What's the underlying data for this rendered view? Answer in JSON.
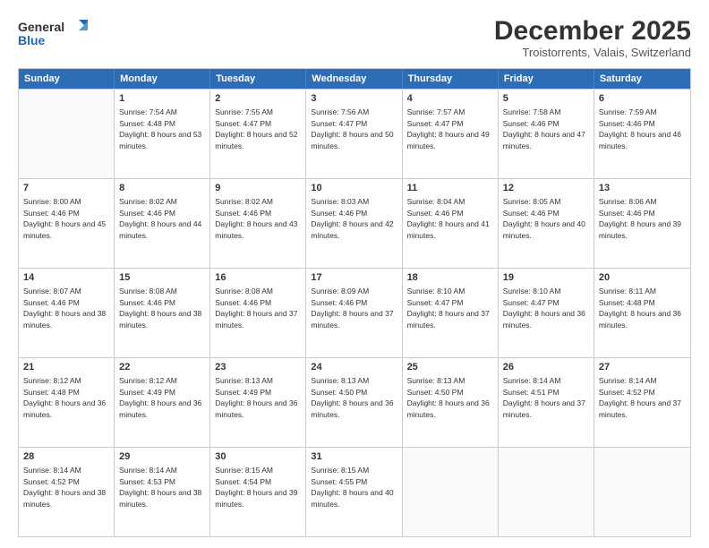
{
  "header": {
    "logo_line1": "General",
    "logo_line2": "Blue",
    "month": "December 2025",
    "location": "Troistorrents, Valais, Switzerland"
  },
  "days_of_week": [
    "Sunday",
    "Monday",
    "Tuesday",
    "Wednesday",
    "Thursday",
    "Friday",
    "Saturday"
  ],
  "weeks": [
    [
      {
        "day": "",
        "empty": true
      },
      {
        "day": "1",
        "sunrise": "7:54 AM",
        "sunset": "4:48 PM",
        "daylight": "8 hours and 53 minutes."
      },
      {
        "day": "2",
        "sunrise": "7:55 AM",
        "sunset": "4:47 PM",
        "daylight": "8 hours and 52 minutes."
      },
      {
        "day": "3",
        "sunrise": "7:56 AM",
        "sunset": "4:47 PM",
        "daylight": "8 hours and 50 minutes."
      },
      {
        "day": "4",
        "sunrise": "7:57 AM",
        "sunset": "4:47 PM",
        "daylight": "8 hours and 49 minutes."
      },
      {
        "day": "5",
        "sunrise": "7:58 AM",
        "sunset": "4:46 PM",
        "daylight": "8 hours and 47 minutes."
      },
      {
        "day": "6",
        "sunrise": "7:59 AM",
        "sunset": "4:46 PM",
        "daylight": "8 hours and 46 minutes."
      }
    ],
    [
      {
        "day": "7",
        "sunrise": "8:00 AM",
        "sunset": "4:46 PM",
        "daylight": "8 hours and 45 minutes."
      },
      {
        "day": "8",
        "sunrise": "8:02 AM",
        "sunset": "4:46 PM",
        "daylight": "8 hours and 44 minutes."
      },
      {
        "day": "9",
        "sunrise": "8:02 AM",
        "sunset": "4:46 PM",
        "daylight": "8 hours and 43 minutes."
      },
      {
        "day": "10",
        "sunrise": "8:03 AM",
        "sunset": "4:46 PM",
        "daylight": "8 hours and 42 minutes."
      },
      {
        "day": "11",
        "sunrise": "8:04 AM",
        "sunset": "4:46 PM",
        "daylight": "8 hours and 41 minutes."
      },
      {
        "day": "12",
        "sunrise": "8:05 AM",
        "sunset": "4:46 PM",
        "daylight": "8 hours and 40 minutes."
      },
      {
        "day": "13",
        "sunrise": "8:06 AM",
        "sunset": "4:46 PM",
        "daylight": "8 hours and 39 minutes."
      }
    ],
    [
      {
        "day": "14",
        "sunrise": "8:07 AM",
        "sunset": "4:46 PM",
        "daylight": "8 hours and 38 minutes."
      },
      {
        "day": "15",
        "sunrise": "8:08 AM",
        "sunset": "4:46 PM",
        "daylight": "8 hours and 38 minutes."
      },
      {
        "day": "16",
        "sunrise": "8:08 AM",
        "sunset": "4:46 PM",
        "daylight": "8 hours and 37 minutes."
      },
      {
        "day": "17",
        "sunrise": "8:09 AM",
        "sunset": "4:46 PM",
        "daylight": "8 hours and 37 minutes."
      },
      {
        "day": "18",
        "sunrise": "8:10 AM",
        "sunset": "4:47 PM",
        "daylight": "8 hours and 37 minutes."
      },
      {
        "day": "19",
        "sunrise": "8:10 AM",
        "sunset": "4:47 PM",
        "daylight": "8 hours and 36 minutes."
      },
      {
        "day": "20",
        "sunrise": "8:11 AM",
        "sunset": "4:48 PM",
        "daylight": "8 hours and 36 minutes."
      }
    ],
    [
      {
        "day": "21",
        "sunrise": "8:12 AM",
        "sunset": "4:48 PM",
        "daylight": "8 hours and 36 minutes."
      },
      {
        "day": "22",
        "sunrise": "8:12 AM",
        "sunset": "4:49 PM",
        "daylight": "8 hours and 36 minutes."
      },
      {
        "day": "23",
        "sunrise": "8:13 AM",
        "sunset": "4:49 PM",
        "daylight": "8 hours and 36 minutes."
      },
      {
        "day": "24",
        "sunrise": "8:13 AM",
        "sunset": "4:50 PM",
        "daylight": "8 hours and 36 minutes."
      },
      {
        "day": "25",
        "sunrise": "8:13 AM",
        "sunset": "4:50 PM",
        "daylight": "8 hours and 36 minutes."
      },
      {
        "day": "26",
        "sunrise": "8:14 AM",
        "sunset": "4:51 PM",
        "daylight": "8 hours and 37 minutes."
      },
      {
        "day": "27",
        "sunrise": "8:14 AM",
        "sunset": "4:52 PM",
        "daylight": "8 hours and 37 minutes."
      }
    ],
    [
      {
        "day": "28",
        "sunrise": "8:14 AM",
        "sunset": "4:52 PM",
        "daylight": "8 hours and 38 minutes."
      },
      {
        "day": "29",
        "sunrise": "8:14 AM",
        "sunset": "4:53 PM",
        "daylight": "8 hours and 38 minutes."
      },
      {
        "day": "30",
        "sunrise": "8:15 AM",
        "sunset": "4:54 PM",
        "daylight": "8 hours and 39 minutes."
      },
      {
        "day": "31",
        "sunrise": "8:15 AM",
        "sunset": "4:55 PM",
        "daylight": "8 hours and 40 minutes."
      },
      {
        "day": "",
        "empty": true
      },
      {
        "day": "",
        "empty": true
      },
      {
        "day": "",
        "empty": true
      }
    ]
  ]
}
